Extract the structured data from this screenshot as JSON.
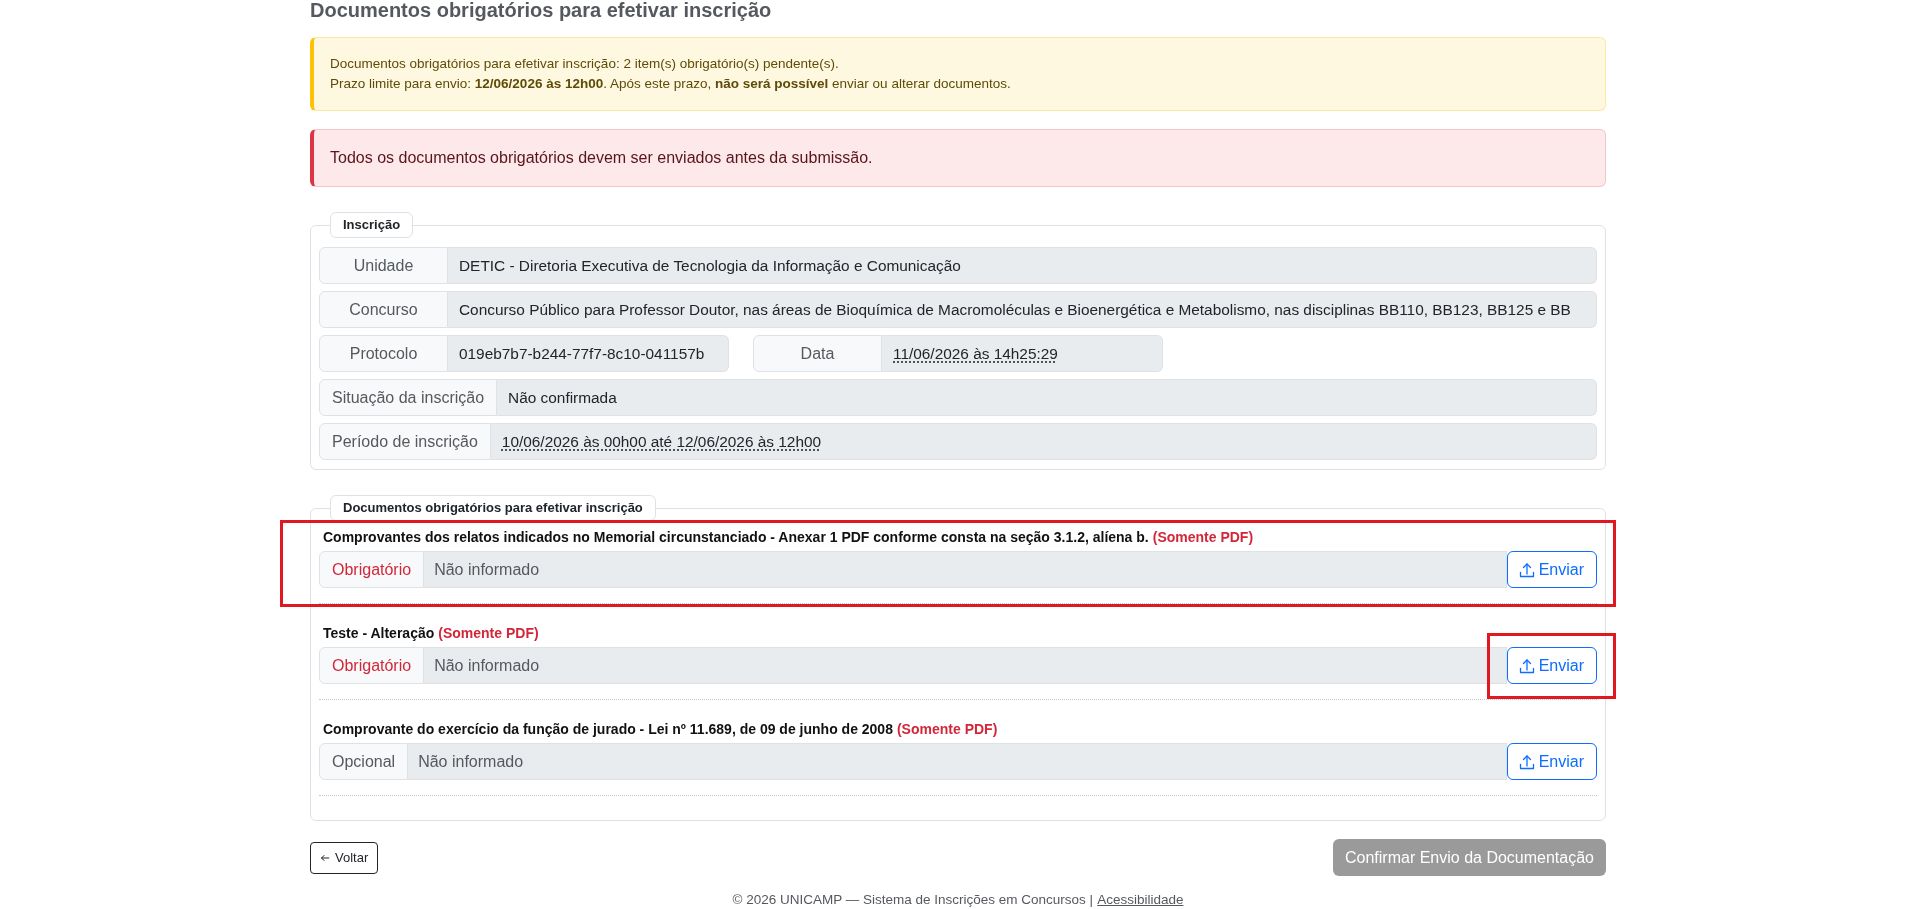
{
  "page": {
    "title": "Documentos obrigatórios para efetivar inscrição"
  },
  "alerts": [
    {
      "kind": "warning",
      "lines": [
        "Documentos obrigatórios para efetivar inscrição: 2 item(s) obrigatório(s) pendente(s).",
        "Prazo limite para envio: **12/06/2026 às 12h00**. Após este prazo, **não será possível** enviar ou alterar documentos."
      ]
    },
    {
      "kind": "danger",
      "lines": [
        "Todos os documentos obrigatórios devem ser enviados antes da submissão."
      ]
    }
  ],
  "registration": {
    "legend": "Inscrição",
    "rows": [
      {
        "fields": [
          {
            "label": "Unidade",
            "value": "DETIC - Diretoria Executiva de Tecnologia da Informação e Comunicação",
            "underlined": false
          }
        ]
      },
      {
        "fields": [
          {
            "label": "Concurso",
            "value": "Concurso Público para Professor Doutor, nas áreas de Bioquímica de Macromoléculas e Bioenergética e Metabolismo, nas disciplinas BB110, BB123, BB125 e BB",
            "underlined": false
          }
        ]
      },
      {
        "fields": [
          {
            "label": "Protocolo",
            "value": "019eb7b7-b244-77f7-8c10-041157b",
            "underlined": false
          },
          {
            "label": "Data",
            "value": "11/06/2026 às 14h25:29",
            "underlined": true
          }
        ]
      },
      {
        "fields": [
          {
            "label": "Situação da inscrição",
            "value": "Não confirmada",
            "underlined": false
          }
        ]
      },
      {
        "fields": [
          {
            "label": "Período de inscrição",
            "value": "10/06/2026 às 00h00 até 12/06/2026 às 12h00",
            "underlined": true
          }
        ]
      }
    ]
  },
  "documents": {
    "legend": "Documentos obrigatórios para efetivar inscrição",
    "items": [
      {
        "title": "Comprovantes dos relatos indicados no Memorial circunstanciado - Anexar 1 PDF conforme consta na seção 3.1.2, alíena b.",
        "note": "(Somente PDF)",
        "required": true,
        "requirement": "Obrigatório",
        "value": "Não informado",
        "highlighted": true,
        "button": {
          "label": "Enviar",
          "highlighted": false
        }
      },
      {
        "title": "Teste - Alteração",
        "note": "(Somente PDF)",
        "required": true,
        "requirement": "Obrigatório",
        "value": "Não informado",
        "highlighted": false,
        "button": {
          "label": "Enviar",
          "highlighted": true
        }
      },
      {
        "title": "Comprovante do exercício da função de jurado - Lei nº 11.689, de 09 de junho de 2008",
        "note": "(Somente PDF)",
        "required": false,
        "requirement": "Opcional",
        "value": "Não informado",
        "highlighted": false,
        "button": {
          "label": "Enviar",
          "highlighted": false
        }
      }
    ]
  },
  "actions": {
    "back": {
      "label": "Voltar"
    },
    "confirm": {
      "label": "Confirmar Envio da Documentação",
      "disabled": true
    }
  },
  "footer": {
    "text": "© 2026 UNICAMP — Sistema de Inscrições em Concursos |",
    "link": "Acessibilidade"
  }
}
